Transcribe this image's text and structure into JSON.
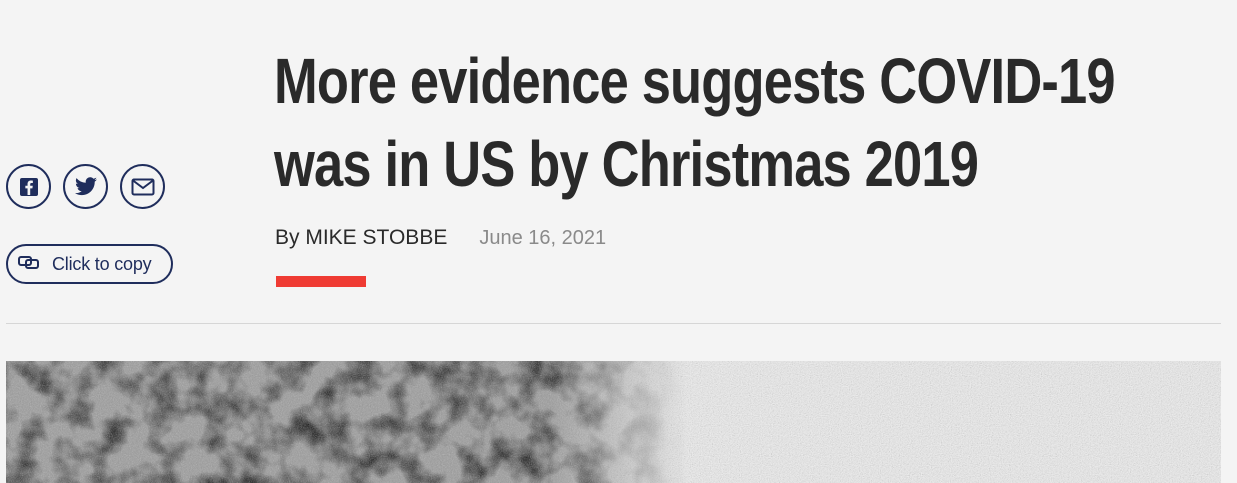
{
  "share": {
    "buttons": [
      {
        "name": "facebook-share-button",
        "icon": "facebook-icon"
      },
      {
        "name": "twitter-share-button",
        "icon": "twitter-icon"
      },
      {
        "name": "email-share-button",
        "icon": "email-icon"
      }
    ],
    "copy_label": "Click to copy",
    "copy_icon": "link-icon"
  },
  "article": {
    "headline": "More evidence suggests COVID-19 was in US by Christmas 2019",
    "byline": "By MIKE STOBBE",
    "date": "June 16, 2021"
  },
  "colors": {
    "accent_red": "#ef3b33",
    "navy": "#1f2d5c",
    "text": "#2a2a2a",
    "muted": "#8a8a8a",
    "background": "#f4f4f4"
  }
}
